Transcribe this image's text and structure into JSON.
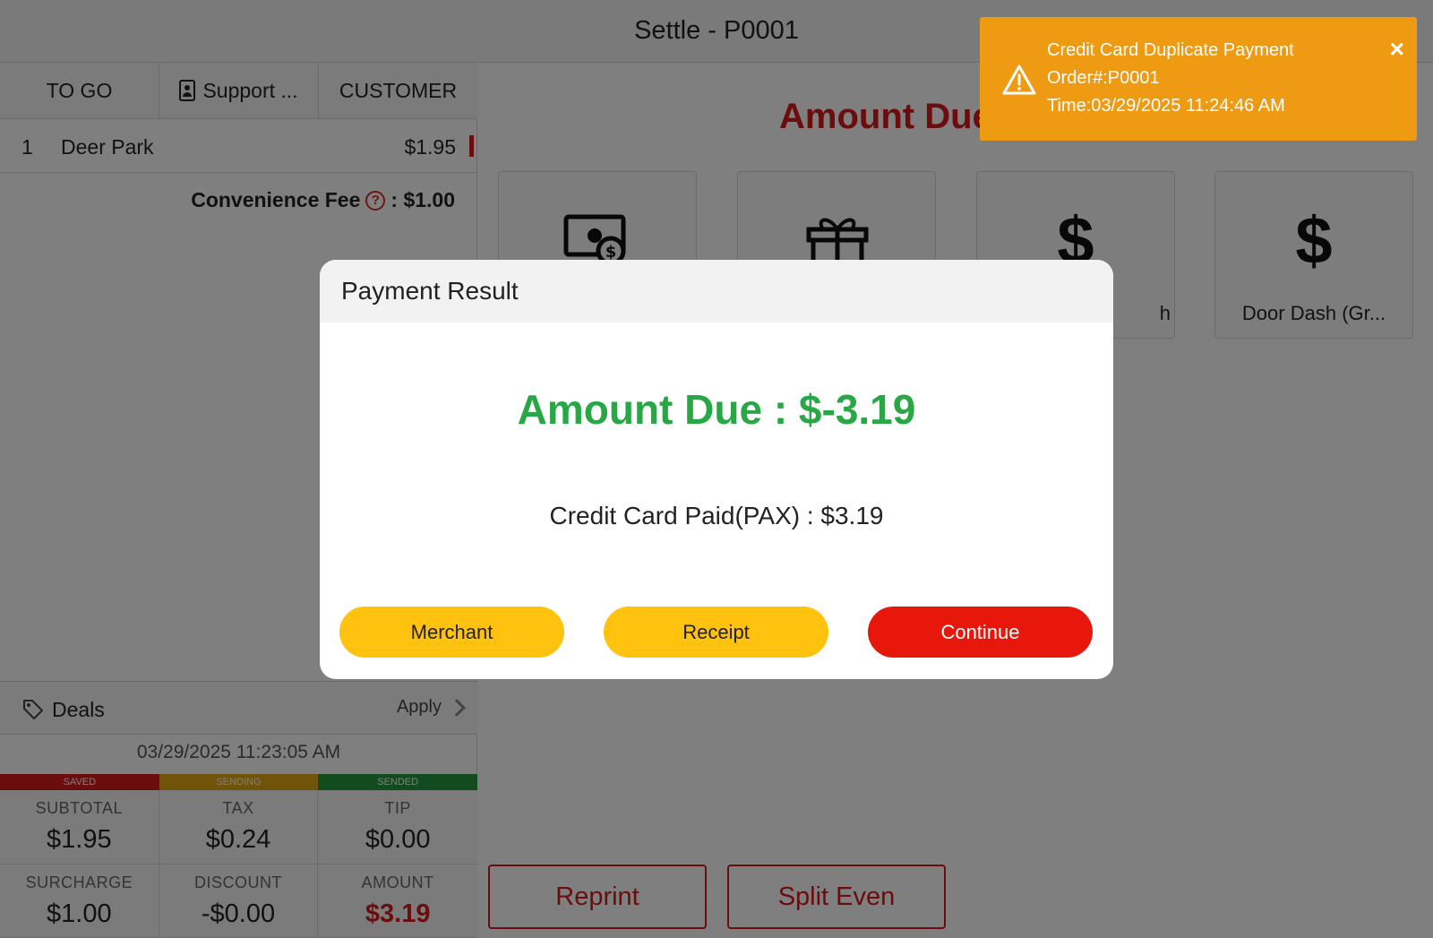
{
  "header": {
    "title": "Settle - P0001"
  },
  "order_tabs": [
    {
      "label": "TO GO"
    },
    {
      "label": "Support ..."
    },
    {
      "label": "CUSTOMER"
    }
  ],
  "items": [
    {
      "qty": "1",
      "name": "Deer Park",
      "price": "$1.95"
    }
  ],
  "fee": {
    "label": "Convenience Fee",
    "help": "?",
    "value": ": $1.00"
  },
  "deals": {
    "label": "Deals",
    "apply": "Apply"
  },
  "order_time": "03/29/2025 11:23:05 AM",
  "status": [
    {
      "label": "SAVED",
      "color": "#d71a1a"
    },
    {
      "label": "SENDING",
      "color": "#e3a712"
    },
    {
      "label": "SENDED",
      "color": "#23963c"
    }
  ],
  "totals": [
    {
      "label": "SUBTOTAL",
      "value": "$1.95"
    },
    {
      "label": "TAX",
      "value": "$0.24"
    },
    {
      "label": "TIP",
      "value": "$0.00"
    },
    {
      "label": "SURCHARGE",
      "value": "$1.00"
    },
    {
      "label": "DISCOUNT",
      "value": "-$0.00"
    },
    {
      "label": "AMOUNT",
      "value": "$3.19"
    }
  ],
  "main": {
    "amount_due": "Amount Due : $-3.19",
    "payment_tiles": [
      {
        "icon": "cash-icon",
        "label": ""
      },
      {
        "icon": "gift-icon",
        "label": ""
      },
      {
        "icon": "dollar-icon",
        "label": "h",
        "glyph": "$"
      },
      {
        "icon": "dollar-icon",
        "label": "Door Dash  (Gr...",
        "glyph": "$"
      }
    ],
    "reprint_label": "Reprint",
    "split_even_label": "Split Even"
  },
  "modal": {
    "title": "Payment Result",
    "amount_due": "Amount Due : $-3.19",
    "paid_line": "Credit Card Paid(PAX) : $3.19",
    "merchant_label": "Merchant",
    "receipt_label": "Receipt",
    "continue_label": "Continue"
  },
  "toast": {
    "title": "Credit Card Duplicate Payment",
    "order": "Order#:P0001",
    "time": "Time:03/29/2025 11:24:46 AM",
    "close": "×"
  }
}
